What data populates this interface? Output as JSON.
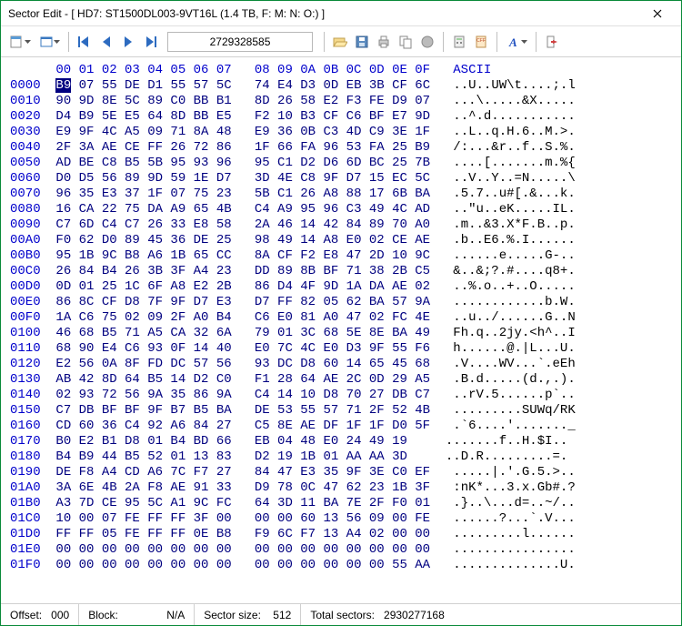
{
  "window": {
    "title": "Sector Edit - [ HD7: ST1500DL003-9VT16L (1.4 TB, F: M: N: O:) ]"
  },
  "toolbar": {
    "sector_value": "2729328585"
  },
  "hex": {
    "header_cols": [
      "00",
      "01",
      "02",
      "03",
      "04",
      "05",
      "06",
      "07",
      "08",
      "09",
      "0A",
      "0B",
      "0C",
      "0D",
      "0E",
      "0F"
    ],
    "ascii_header": "ASCII",
    "rows": [
      {
        "off": "0000",
        "b": [
          "B9",
          "07",
          "55",
          "DE",
          "D1",
          "55",
          "57",
          "5C",
          "74",
          "E4",
          "D3",
          "0D",
          "EB",
          "3B",
          "CF",
          "6C"
        ],
        "a": "..U..UW\\t....;.l"
      },
      {
        "off": "0010",
        "b": [
          "90",
          "9D",
          "8E",
          "5C",
          "89",
          "C0",
          "BB",
          "B1",
          "8D",
          "26",
          "58",
          "E2",
          "F3",
          "FE",
          "D9",
          "07"
        ],
        "a": "...\\.....&X....."
      },
      {
        "off": "0020",
        "b": [
          "D4",
          "B9",
          "5E",
          "E5",
          "64",
          "8D",
          "BB",
          "E5",
          "F2",
          "10",
          "B3",
          "CF",
          "C6",
          "BF",
          "E7",
          "9D"
        ],
        "a": "..^.d..........."
      },
      {
        "off": "0030",
        "b": [
          "E9",
          "9F",
          "4C",
          "A5",
          "09",
          "71",
          "8A",
          "48",
          "E9",
          "36",
          "0B",
          "C3",
          "4D",
          "C9",
          "3E",
          "1F"
        ],
        "a": "..L..q.H.6..M.>."
      },
      {
        "off": "0040",
        "b": [
          "2F",
          "3A",
          "AE",
          "CE",
          "FF",
          "26",
          "72",
          "86",
          "1F",
          "66",
          "FA",
          "96",
          "53",
          "FA",
          "25",
          "B9"
        ],
        "a": "/:...&r..f..S.%."
      },
      {
        "off": "0050",
        "b": [
          "AD",
          "BE",
          "C8",
          "B5",
          "5B",
          "95",
          "93",
          "96",
          "95",
          "C1",
          "D2",
          "D6",
          "6D",
          "BC",
          "25",
          "7B"
        ],
        "a": "....[.......m.%{"
      },
      {
        "off": "0060",
        "b": [
          "D0",
          "D5",
          "56",
          "89",
          "9D",
          "59",
          "1E",
          "D7",
          "3D",
          "4E",
          "C8",
          "9F",
          "D7",
          "15",
          "EC",
          "5C"
        ],
        "a": "..V..Y..=N.....\\"
      },
      {
        "off": "0070",
        "b": [
          "96",
          "35",
          "E3",
          "37",
          "1F",
          "07",
          "75",
          "23",
          "5B",
          "C1",
          "26",
          "A8",
          "88",
          "17",
          "6B",
          "BA"
        ],
        "a": ".5.7..u#[.&...k."
      },
      {
        "off": "0080",
        "b": [
          "16",
          "CA",
          "22",
          "75",
          "DA",
          "A9",
          "65",
          "4B",
          "C4",
          "A9",
          "95",
          "96",
          "C3",
          "49",
          "4C",
          "AD"
        ],
        "a": "..\"u..eK.....IL."
      },
      {
        "off": "0090",
        "b": [
          "C7",
          "6D",
          "C4",
          "C7",
          "26",
          "33",
          "E8",
          "58",
          "2A",
          "46",
          "14",
          "42",
          "84",
          "89",
          "70",
          "A0"
        ],
        "a": ".m..&3.X*F.B..p."
      },
      {
        "off": "00A0",
        "b": [
          "F0",
          "62",
          "D0",
          "89",
          "45",
          "36",
          "DE",
          "25",
          "98",
          "49",
          "14",
          "A8",
          "E0",
          "02",
          "CE",
          "AE"
        ],
        "a": ".b..E6.%.I......"
      },
      {
        "off": "00B0",
        "b": [
          "95",
          "1B",
          "9C",
          "B8",
          "A6",
          "1B",
          "65",
          "CC",
          "8A",
          "CF",
          "F2",
          "E8",
          "47",
          "2D",
          "10",
          "9C"
        ],
        "a": "......e.....G-.."
      },
      {
        "off": "00C0",
        "b": [
          "26",
          "84",
          "B4",
          "26",
          "3B",
          "3F",
          "A4",
          "23",
          "DD",
          "89",
          "8B",
          "BF",
          "71",
          "38",
          "2B",
          "C5"
        ],
        "a": "&..&;?.#....q8+."
      },
      {
        "off": "00D0",
        "b": [
          "0D",
          "01",
          "25",
          "1C",
          "6F",
          "A8",
          "E2",
          "2B",
          "86",
          "D4",
          "4F",
          "9D",
          "1A",
          "DA",
          "AE",
          "02"
        ],
        "a": "..%.o..+..O....."
      },
      {
        "off": "00E0",
        "b": [
          "86",
          "8C",
          "CF",
          "D8",
          "7F",
          "9F",
          "D7",
          "E3",
          "D7",
          "FF",
          "82",
          "05",
          "62",
          "BA",
          "57",
          "9A"
        ],
        "a": "............b.W."
      },
      {
        "off": "00F0",
        "b": [
          "1A",
          "C6",
          "75",
          "02",
          "09",
          "2F",
          "A0",
          "B4",
          "C6",
          "E0",
          "81",
          "A0",
          "47",
          "02",
          "FC",
          "4E"
        ],
        "a": "..u../......G..N"
      },
      {
        "off": "0100",
        "b": [
          "46",
          "68",
          "B5",
          "71",
          "A5",
          "CA",
          "32",
          "6A",
          "79",
          "01",
          "3C",
          "68",
          "5E",
          "8E",
          "BA",
          "49"
        ],
        "a": "Fh.q..2jy.<h^..I"
      },
      {
        "off": "0110",
        "b": [
          "68",
          "90",
          "E4",
          "C6",
          "93",
          "0F",
          "14",
          "40",
          "E0",
          "7C",
          "4C",
          "E0",
          "D3",
          "9F",
          "55",
          "F6"
        ],
        "a": "h......@.|L...U."
      },
      {
        "off": "0120",
        "b": [
          "E2",
          "56",
          "0A",
          "8F",
          "FD",
          "DC",
          "57",
          "56",
          "93",
          "DC",
          "D8",
          "60",
          "14",
          "65",
          "45",
          "68"
        ],
        "a": ".V....WV...`.eEh"
      },
      {
        "off": "0130",
        "b": [
          "AB",
          "42",
          "8D",
          "64",
          "B5",
          "14",
          "D2",
          "C0",
          "F1",
          "28",
          "64",
          "AE",
          "2C",
          "0D",
          "29",
          "A5"
        ],
        "a": ".B.d.....(d.,.)."
      },
      {
        "off": "0140",
        "b": [
          "02",
          "93",
          "72",
          "56",
          "9A",
          "35",
          "86",
          "9A",
          "C4",
          "14",
          "10",
          "D8",
          "70",
          "27",
          "DB",
          "C7"
        ],
        "a": "..rV.5......p`.."
      },
      {
        "off": "0150",
        "b": [
          "C7",
          "DB",
          "BF",
          "BF",
          "9F",
          "B7",
          "B5",
          "BA",
          "DE",
          "53",
          "55",
          "57",
          "71",
          "2F",
          "52",
          "4B"
        ],
        "a": ".........SUWq/RK"
      },
      {
        "off": "0160",
        "b": [
          "CD",
          "60",
          "36",
          "C4",
          "92",
          "A6",
          "84",
          "27",
          "C5",
          "8E",
          "AE",
          "DF",
          "1F",
          "1F",
          "D0",
          "5F"
        ],
        "a": ".`6....'......._"
      },
      {
        "off": "0170",
        "b": [
          "B0",
          "E2",
          "B1",
          "D8",
          "01",
          "B4",
          "BD",
          "66",
          "EB",
          "04",
          "48",
          "E0",
          "24",
          "49",
          "19",
          " "
        ],
        "a": ".......f..H.$I.."
      },
      {
        "off": "0180",
        "b": [
          "B4",
          "B9",
          "44",
          "B5",
          "52",
          "01",
          "13",
          "83",
          "D2",
          "19",
          "1B",
          "01",
          "AA",
          "AA",
          "3D",
          " "
        ],
        "a": "..D.R.........=."
      },
      {
        "off": "0190",
        "b": [
          "DE",
          "F8",
          "A4",
          "CD",
          "A6",
          "7C",
          "F7",
          "27",
          "84",
          "47",
          "E3",
          "35",
          "9F",
          "3E",
          "C0",
          "EF"
        ],
        "a": ".....|.'.G.5.>.."
      },
      {
        "off": "01A0",
        "b": [
          "3A",
          "6E",
          "4B",
          "2A",
          "F8",
          "AE",
          "91",
          "33",
          "D9",
          "78",
          "0C",
          "47",
          "62",
          "23",
          "1B",
          "3F"
        ],
        "a": ":nK*...3.x.Gb#.?"
      },
      {
        "off": "01B0",
        "b": [
          "A3",
          "7D",
          "CE",
          "95",
          "5C",
          "A1",
          "9C",
          "FC",
          "64",
          "3D",
          "11",
          "BA",
          "7E",
          "2F",
          "F0",
          "01"
        ],
        "a": ".}..\\...d=..~/.."
      },
      {
        "off": "01C0",
        "b": [
          "10",
          "00",
          "07",
          "FE",
          "FF",
          "FF",
          "3F",
          "00",
          "00",
          "00",
          "60",
          "13",
          "56",
          "09",
          "00",
          "FE"
        ],
        "a": "......?...`.V..."
      },
      {
        "off": "01D0",
        "b": [
          "FF",
          "FF",
          "05",
          "FE",
          "FF",
          "FF",
          "0E",
          "B8",
          "F9",
          "6C",
          "F7",
          "13",
          "A4",
          "02",
          "00",
          "00"
        ],
        "a": ".........l......"
      },
      {
        "off": "01E0",
        "b": [
          "00",
          "00",
          "00",
          "00",
          "00",
          "00",
          "00",
          "00",
          "00",
          "00",
          "00",
          "00",
          "00",
          "00",
          "00",
          "00"
        ],
        "a": "................"
      },
      {
        "off": "01F0",
        "b": [
          "00",
          "00",
          "00",
          "00",
          "00",
          "00",
          "00",
          "00",
          "00",
          "00",
          "00",
          "00",
          "00",
          "00",
          "55",
          "AA"
        ],
        "a": "..............U."
      }
    ]
  },
  "status": {
    "offset_label": "Offset:",
    "offset_val": "000",
    "block_label": "Block:",
    "block_val": "N/A",
    "sectorsize_label": "Sector size:",
    "sectorsize_val": "512",
    "totalsect_label": "Total sectors:",
    "totalsect_val": "2930277168"
  }
}
